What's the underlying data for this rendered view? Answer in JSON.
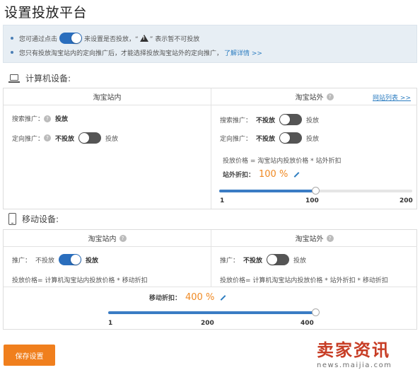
{
  "page": {
    "title": "设置投放平台"
  },
  "notice": {
    "line1_prefix": "您可通过点击",
    "line1_middle": "来设置是否投放，“",
    "line1_suffix": "” 表示暂不可投放",
    "line2_text": "您只有投放淘宝站内的定向推广后，才能选择投放淘宝站外的定向推广，",
    "line2_link": "了解详情 >>"
  },
  "pc": {
    "title": "计算机设备:",
    "inside": {
      "header": "淘宝站内",
      "search": {
        "label": "搜索推广：",
        "value": "投放"
      },
      "targeted": {
        "label": "定向推广：",
        "off_label": "不投放",
        "on_label": "投放"
      }
    },
    "outside": {
      "header": "淘宝站外",
      "site_list_link": "网站列表 >>",
      "search": {
        "label": "搜索推广：",
        "off_label": "不投放",
        "on_label": "投放"
      },
      "targeted": {
        "label": "定向推广：",
        "off_label": "不投放",
        "on_label": "投放"
      },
      "price_note": "投放价格 = 淘宝站内投放价格 * 站外折扣",
      "discount_label": "站外折扣：",
      "discount_value": "100 %",
      "slider": {
        "min": 1,
        "max": 200,
        "value": 100,
        "ticks": [
          "1",
          "100",
          "200"
        ]
      }
    }
  },
  "mobile": {
    "title": "移动设备:",
    "inside": {
      "header": "淘宝站内",
      "promo": {
        "label": "推广：",
        "off_label": "不投放",
        "on_label": "投放"
      },
      "price_note": "投放价格= 计算机淘宝站内投放价格 * 移动折扣"
    },
    "outside": {
      "header": "淘宝站外",
      "promo": {
        "label": "推广：",
        "off_label": "不投放",
        "on_label": "投放"
      },
      "price_note": "投放价格= 计算机淘宝站内投放价格 * 站外折扣 * 移动折扣"
    },
    "discount_label": "移动折扣：",
    "discount_value": "400 %",
    "slider": {
      "min": 1,
      "max": 400,
      "value": 400,
      "ticks": [
        "1",
        "200",
        "400"
      ]
    }
  },
  "actions": {
    "save_label": "保存设置"
  },
  "watermark": {
    "brand": "卖家资讯",
    "domain": "news.maijia.com"
  },
  "colors": {
    "accent": "#2a6ebd",
    "orange": "#f07f1d",
    "notice_bg": "#e7eef4"
  }
}
